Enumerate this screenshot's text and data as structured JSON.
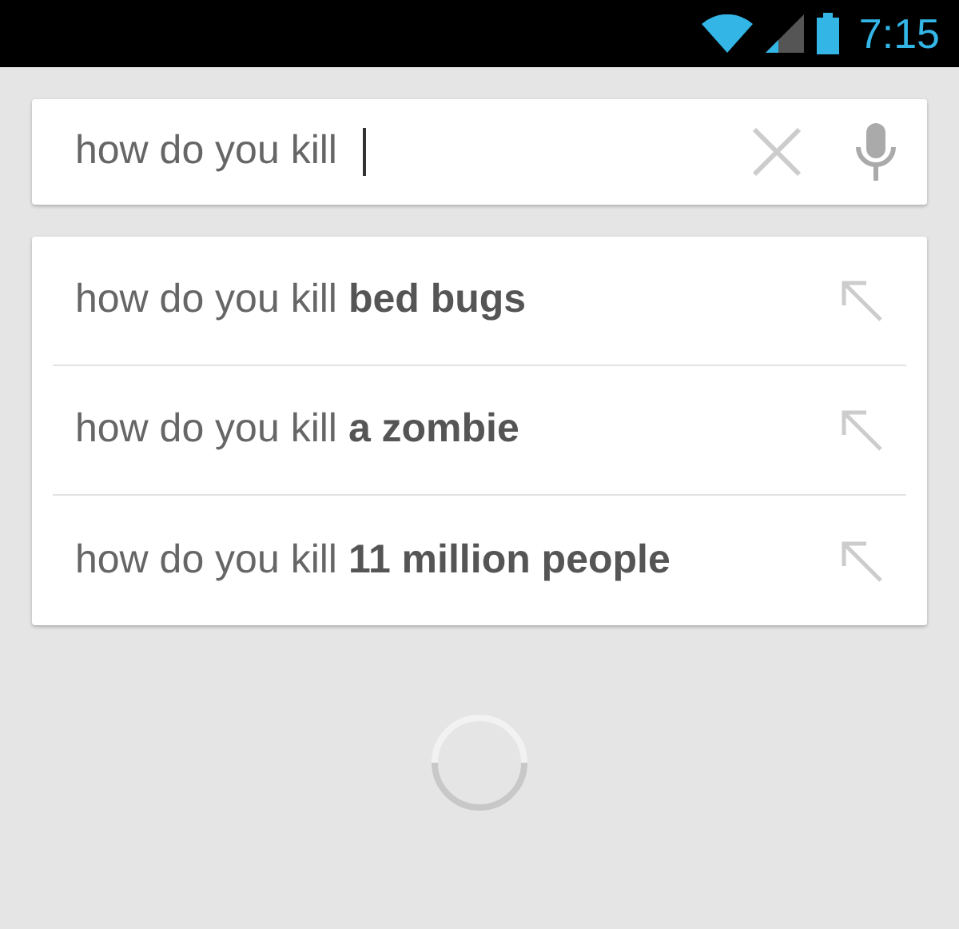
{
  "status_bar": {
    "time": "7:15"
  },
  "search": {
    "value": "how do you kill"
  },
  "suggestions": [
    {
      "text": "how do you kill **bed bugs**"
    },
    {
      "text": "how do you kill **a zombie**"
    },
    {
      "text": "how do you kill **11 million people**"
    }
  ]
}
